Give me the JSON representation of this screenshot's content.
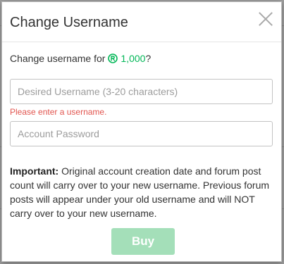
{
  "dialog": {
    "title": "Change Username",
    "prompt_prefix": "Change username for",
    "price": "1,000",
    "prompt_suffix": "?",
    "username_placeholder": "Desired Username (3-20 characters)",
    "username_value": "",
    "username_error": "Please enter a username.",
    "password_placeholder": "Account Password",
    "password_value": "",
    "notice_label": "Important:",
    "notice_text": "Original account creation date and forum post count will carry over to your new username. Previous forum posts will appear under your old username and will NOT carry over to your new username.",
    "buy_label": "Buy"
  },
  "colors": {
    "price_green": "#02b757",
    "error_red": "#e2554f",
    "buy_disabled_bg": "#a4dfb9"
  },
  "icons": {
    "close": "close-icon",
    "currency": "robux-icon"
  }
}
